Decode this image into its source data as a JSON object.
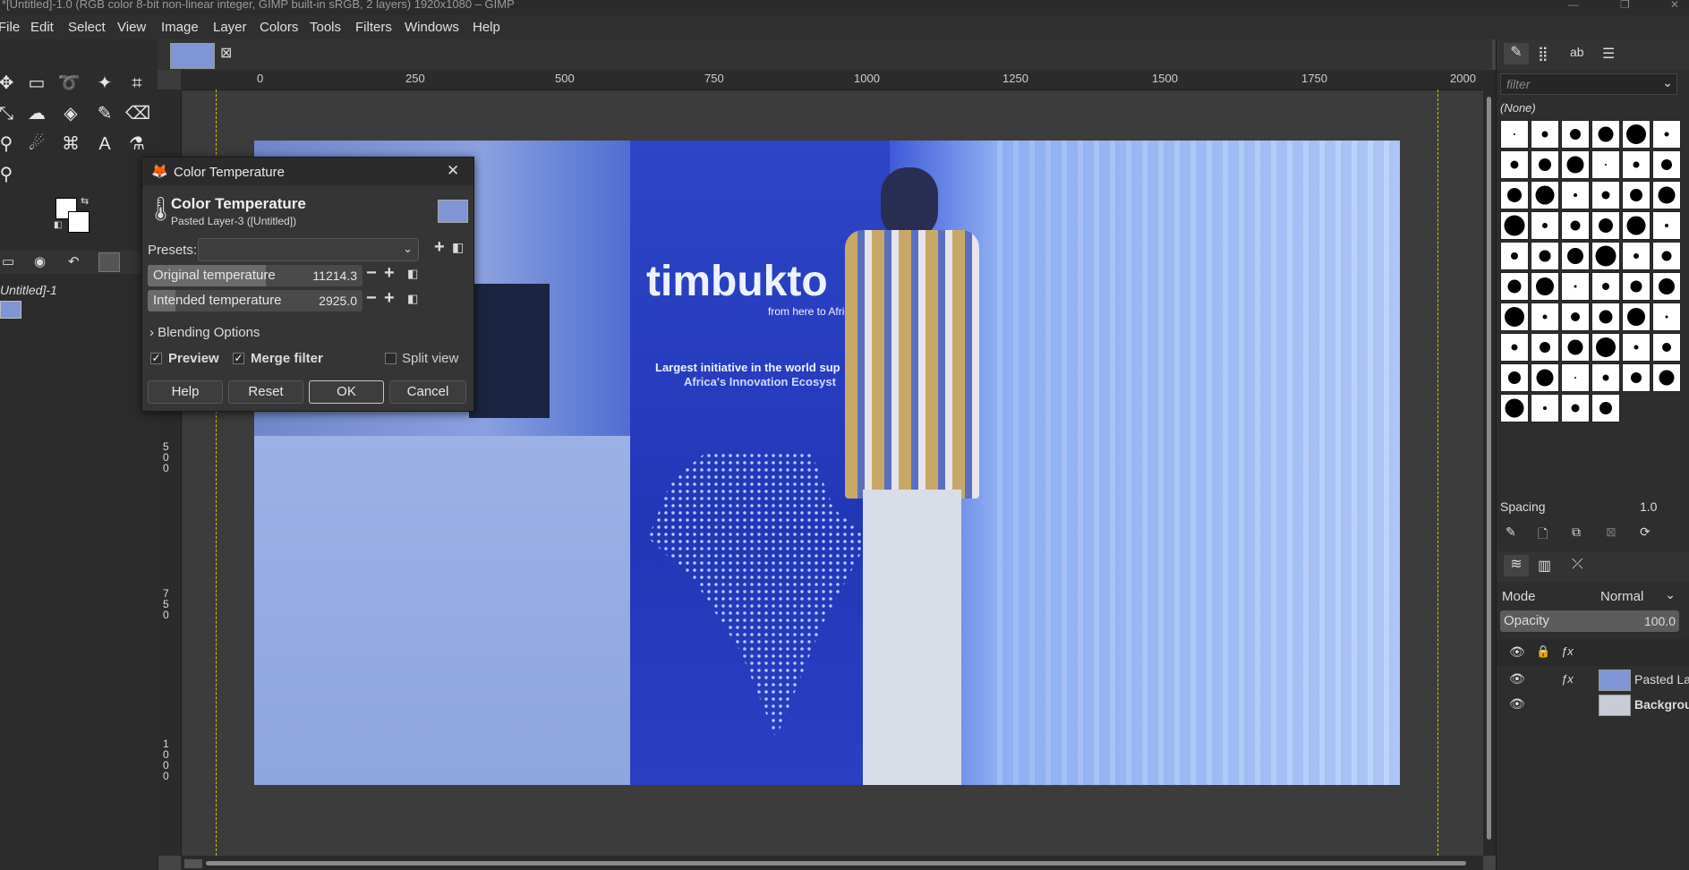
{
  "window": {
    "title": "*[Untitled]-1.0 (RGB color 8-bit non-linear integer, GIMP built-in sRGB, 2 layers) 1920x1080 – GIMP",
    "controls": [
      "—",
      "❐",
      "✕"
    ]
  },
  "menubar": [
    "File",
    "Edit",
    "Select",
    "View",
    "Image",
    "Layer",
    "Colors",
    "Tools",
    "Filters",
    "Windows",
    "Help"
  ],
  "toolbox": {
    "image_list_label": "Untitled]-1"
  },
  "rulers": {
    "horizontal": [
      "0",
      "250",
      "500",
      "750",
      "1000",
      "1250",
      "1500",
      "1750",
      "2000"
    ],
    "vertical": [
      "5",
      "0",
      "0",
      "7",
      "5",
      "0",
      "1",
      "0",
      "0",
      "0"
    ]
  },
  "photo": {
    "banner_brand": "timbukto",
    "banner_tagline": "from here to Afric",
    "banner_line1": "Largest initiative in the world sup",
    "banner_line2": "Africa's Innovation Ecosyst"
  },
  "dialog": {
    "window_title": "Color Temperature",
    "heading": "Color Temperature",
    "subheading": "Pasted Layer-3 ([Untitled])",
    "presets_label": "Presets:",
    "presets_value": "",
    "original_label": "Original temperature",
    "original_value": "11214.3",
    "original_fraction": 0.55,
    "intended_label": "Intended temperature",
    "intended_value": "2925.0",
    "intended_fraction": 0.13,
    "blending_label": "Blending Options",
    "preview_label": "Preview",
    "preview_checked": true,
    "merge_label": "Merge filter",
    "merge_checked": true,
    "split_label": "Split view",
    "split_checked": false,
    "help": "Help",
    "reset": "Reset",
    "ok": "OK",
    "cancel": "Cancel"
  },
  "dock": {
    "filter_placeholder": "filter",
    "brush_selected": "(None)",
    "spacing_label": "Spacing",
    "spacing_value": "1.0",
    "mode_label": "Mode",
    "mode_value": "Normal",
    "opacity_label": "Opacity",
    "opacity_value": "100.0",
    "layers": [
      {
        "name": "Pasted La",
        "fx": true
      },
      {
        "name": "Backgrou",
        "fx": false
      }
    ]
  },
  "colors": {
    "accent": "#4a89dc",
    "dialog_bg": "#353535",
    "app_bg": "#2c2c2c"
  }
}
